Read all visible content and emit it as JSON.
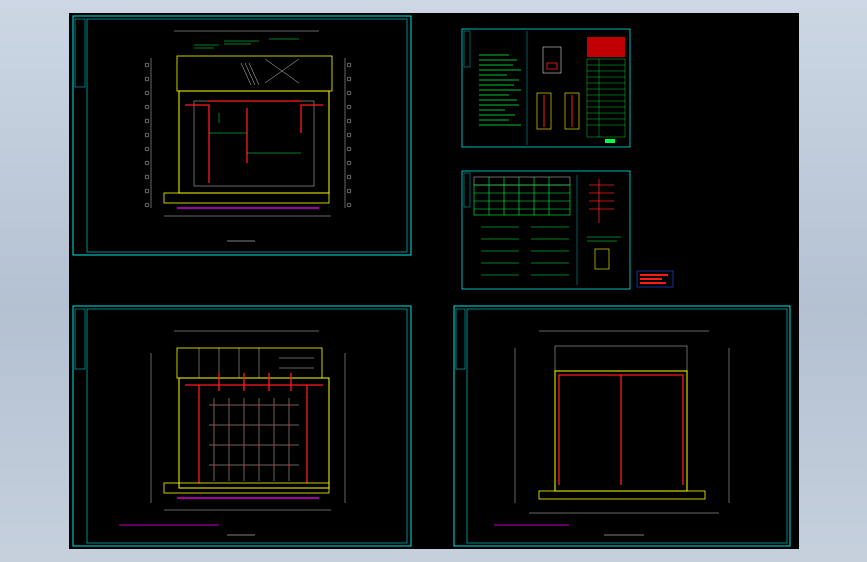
{
  "viewport": {
    "background": "#000000"
  },
  "sheets": [
    {
      "key": "plan-top-left",
      "title": ""
    },
    {
      "key": "plan-bottom-left",
      "title": ""
    },
    {
      "key": "plan-bottom-right",
      "title": ""
    },
    {
      "key": "notes-top-right",
      "title": ""
    },
    {
      "key": "table-middle-right",
      "title": ""
    }
  ],
  "colors": {
    "frame": "#00e5e5",
    "wall": "#ffff00",
    "pipe": "#ff1a1a",
    "text": "#00ff40",
    "dim": "#ffffff",
    "hatch": "#ff00ff",
    "legend_fill": "#c00000"
  }
}
